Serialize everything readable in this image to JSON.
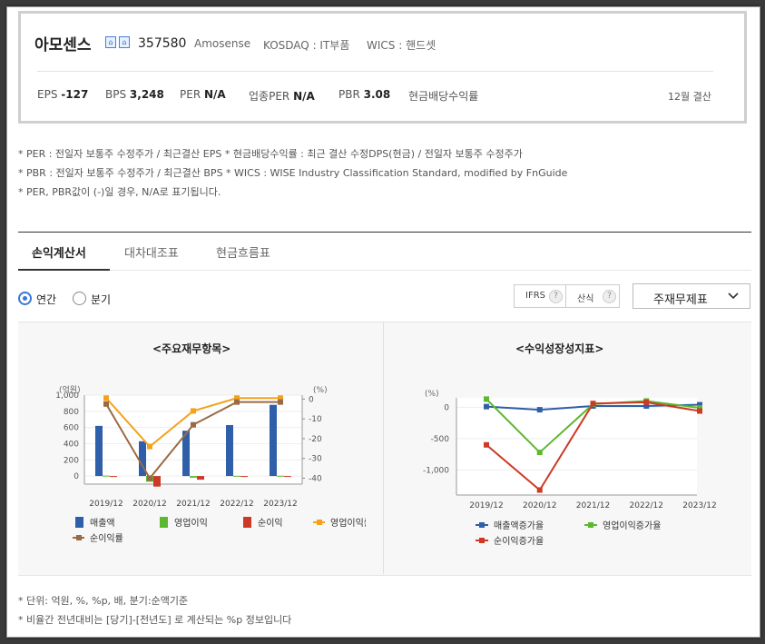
{
  "company": {
    "name": "아모센스",
    "code": "357580",
    "eng_name": "Amosense",
    "market": "KOSDAQ : IT부품",
    "wics": "WICS : 핸드셋"
  },
  "metrics": {
    "eps_label": "EPS",
    "eps_value": "-127",
    "bps_label": "BPS",
    "bps_value": "3,248",
    "per_label": "PER",
    "per_value": "N/A",
    "ind_per_label": "업종PER",
    "ind_per_value": "N/A",
    "pbr_label": "PBR",
    "pbr_value": "3.08",
    "div_label": "현금배당수익률",
    "settle": "12월 결산"
  },
  "notes": [
    "* PER : 전일자 보통주 수정주가 / 최근결산 EPS * 현금배당수익률 : 최근 결산 수정DPS(현금) / 전일자 보통주 수정주가",
    "* PBR : 전일자 보통주 수정주가 / 최근결산 BPS * WICS : WISE Industry Classification Standard, modified by FnGuide",
    "* PER, PBR값이 (-)일 경우, N/A로 표기됩니다."
  ],
  "tabs": [
    "손익계산서",
    "대차대조표",
    "현금흐름표"
  ],
  "period": {
    "annual": "연간",
    "quarter": "분기"
  },
  "controls": {
    "ifrs": "IFRS",
    "sansik": "산식",
    "q": "?",
    "select": "주재무제표"
  },
  "colors": {
    "sales": "#2e5fa8",
    "op": "#5cb82e",
    "net": "#cc3a25",
    "op_margin": "#f5a21b",
    "net_margin": "#9a6a44"
  },
  "chart_data": [
    {
      "type": "bar",
      "title": "<주요재무항목>",
      "unit_left": "(억원)",
      "unit_right": "(%)",
      "categories": [
        "2019/12",
        "2020/12",
        "2021/12",
        "2022/12",
        "2023/12"
      ],
      "ylim": [
        -100,
        1000
      ],
      "yticks": [
        "1,000",
        "800",
        "600",
        "400",
        "200",
        "0"
      ],
      "y2lim": [
        -43,
        2
      ],
      "y2ticks": [
        "0",
        "-10",
        "-20",
        "-30",
        "-40"
      ],
      "series": [
        {
          "name": "매출액",
          "kind": "bar",
          "values": [
            620,
            430,
            560,
            630,
            880
          ]
        },
        {
          "name": "영업이익",
          "kind": "bar",
          "values": [
            5,
            -70,
            -20,
            3,
            4
          ]
        },
        {
          "name": "순이익",
          "kind": "bar",
          "values": [
            -5,
            -130,
            -45,
            -3,
            -5
          ]
        },
        {
          "name": "영업이익률",
          "kind": "line",
          "axis": "right",
          "values": [
            0.5,
            -24,
            -6,
            0.5,
            0.5
          ]
        },
        {
          "name": "순이익률",
          "kind": "line",
          "axis": "right",
          "values": [
            -2.5,
            -40,
            -13,
            -1.5,
            -1.5
          ]
        }
      ]
    },
    {
      "type": "line",
      "title": "<수익성장성지표>",
      "unit_left": "(%)",
      "categories": [
        "2019/12",
        "2020/12",
        "2021/12",
        "2022/12",
        "2023/12"
      ],
      "ylim": [
        -1400,
        150
      ],
      "yticks": [
        "0",
        "-500",
        "-1,000"
      ],
      "series": [
        {
          "name": "매출액증가율",
          "values": [
            10,
            -40,
            20,
            20,
            40
          ]
        },
        {
          "name": "영업이익증가율",
          "values": [
            130,
            -720,
            50,
            100,
            -10
          ]
        },
        {
          "name": "순이익증가율",
          "values": [
            -600,
            -1320,
            60,
            80,
            -60
          ]
        }
      ]
    }
  ],
  "footnotes": [
    "* 단위: 억원, %, %p, 배, 분기:순액기준",
    "* 비율간 전년대비는 [당기]-[전년도] 로 계산되는 %p 정보입니다"
  ]
}
